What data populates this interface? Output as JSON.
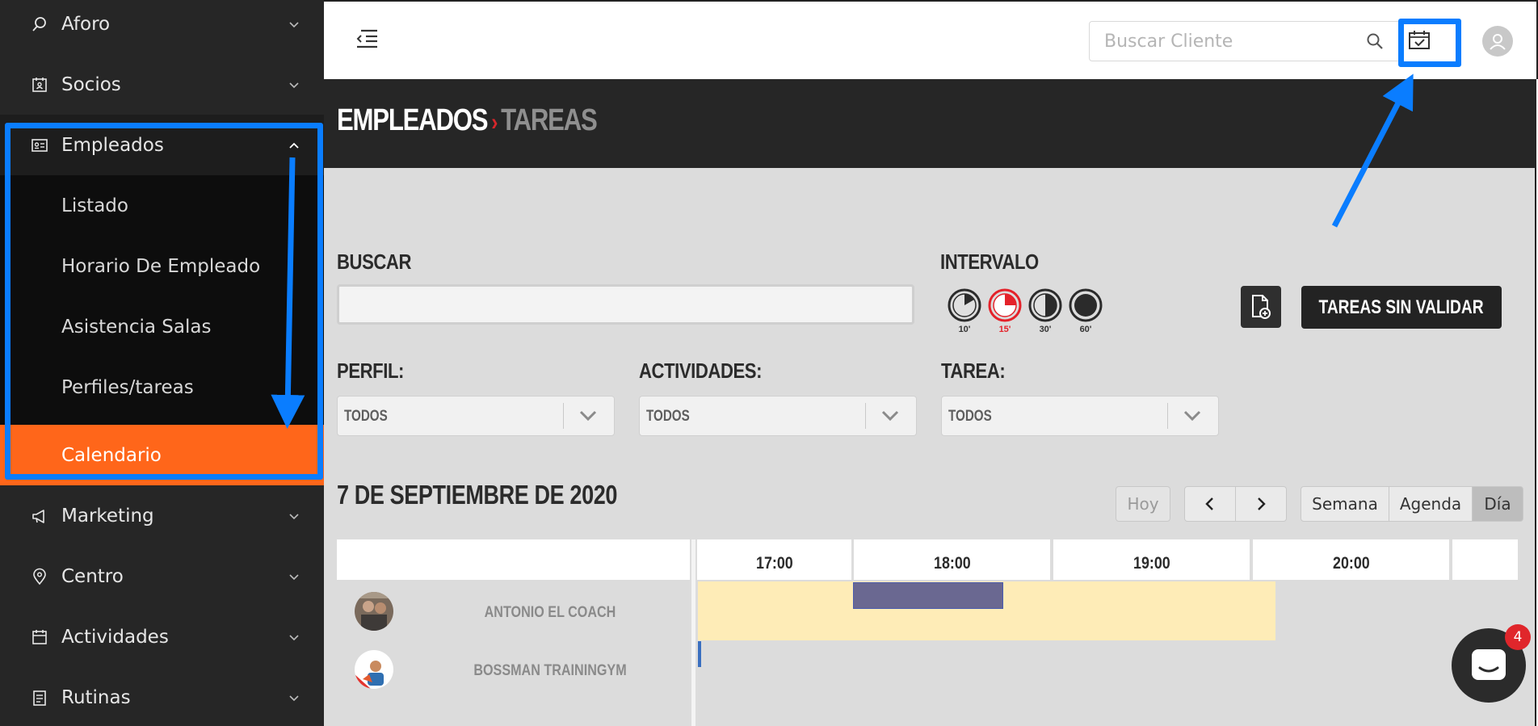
{
  "sidebar": {
    "items": [
      {
        "label": "Aforo",
        "icon": "search-location-icon"
      },
      {
        "label": "Socios",
        "icon": "member-card-icon"
      },
      {
        "label": "Empleados",
        "icon": "id-card-icon"
      },
      {
        "label": "Marketing",
        "icon": "megaphone-icon"
      },
      {
        "label": "Centro",
        "icon": "map-pin-icon"
      },
      {
        "label": "Actividades",
        "icon": "calendar-icon"
      },
      {
        "label": "Rutinas",
        "icon": "clipboard-icon"
      }
    ],
    "empleados_submenu": [
      {
        "label": "Listado"
      },
      {
        "label": "Horario De Empleado"
      },
      {
        "label": "Asistencia Salas"
      },
      {
        "label": "Perfiles/tareas"
      },
      {
        "label": "Calendario"
      }
    ]
  },
  "topbar": {
    "search_placeholder": "Buscar Cliente"
  },
  "breadcrumb": {
    "section": "EMPLEADOS",
    "separator": "›",
    "page": "TAREAS"
  },
  "filters": {
    "buscar_label": "BUSCAR",
    "intervalo_label": "INTERVALO",
    "intervals": [
      {
        "label": "10'",
        "selected": false
      },
      {
        "label": "15'",
        "selected": true
      },
      {
        "label": "30'",
        "selected": false
      },
      {
        "label": "60'",
        "selected": false
      }
    ],
    "tareas_sin_validar": "TAREAS SIN VALIDAR",
    "perfil_label": "PERFIL:",
    "perfil_value": "TODOS",
    "actividades_label": "ACTIVIDADES:",
    "actividades_value": "TODOS",
    "tarea_label": "TAREA:",
    "tarea_value": "TODOS"
  },
  "calendar": {
    "date_title": "7 DE SEPTIEMBRE DE 2020",
    "today_button": "Hoy",
    "views": [
      "Semana",
      "Agenda",
      "Día"
    ],
    "active_view": "Día",
    "hours": [
      "17:00",
      "18:00",
      "19:00",
      "20:00"
    ],
    "employees": [
      {
        "name": "ANTONIO EL COACH"
      },
      {
        "name": "BOSSMAN TRAININGYM"
      }
    ]
  },
  "chat": {
    "unread_count": "4"
  },
  "colors": {
    "accent_orange": "#ff661a",
    "annotation_blue": "#0a7dff",
    "brand_red": "#d6262b",
    "event_yellow": "#feecb7",
    "event_purple": "#6a6891"
  }
}
